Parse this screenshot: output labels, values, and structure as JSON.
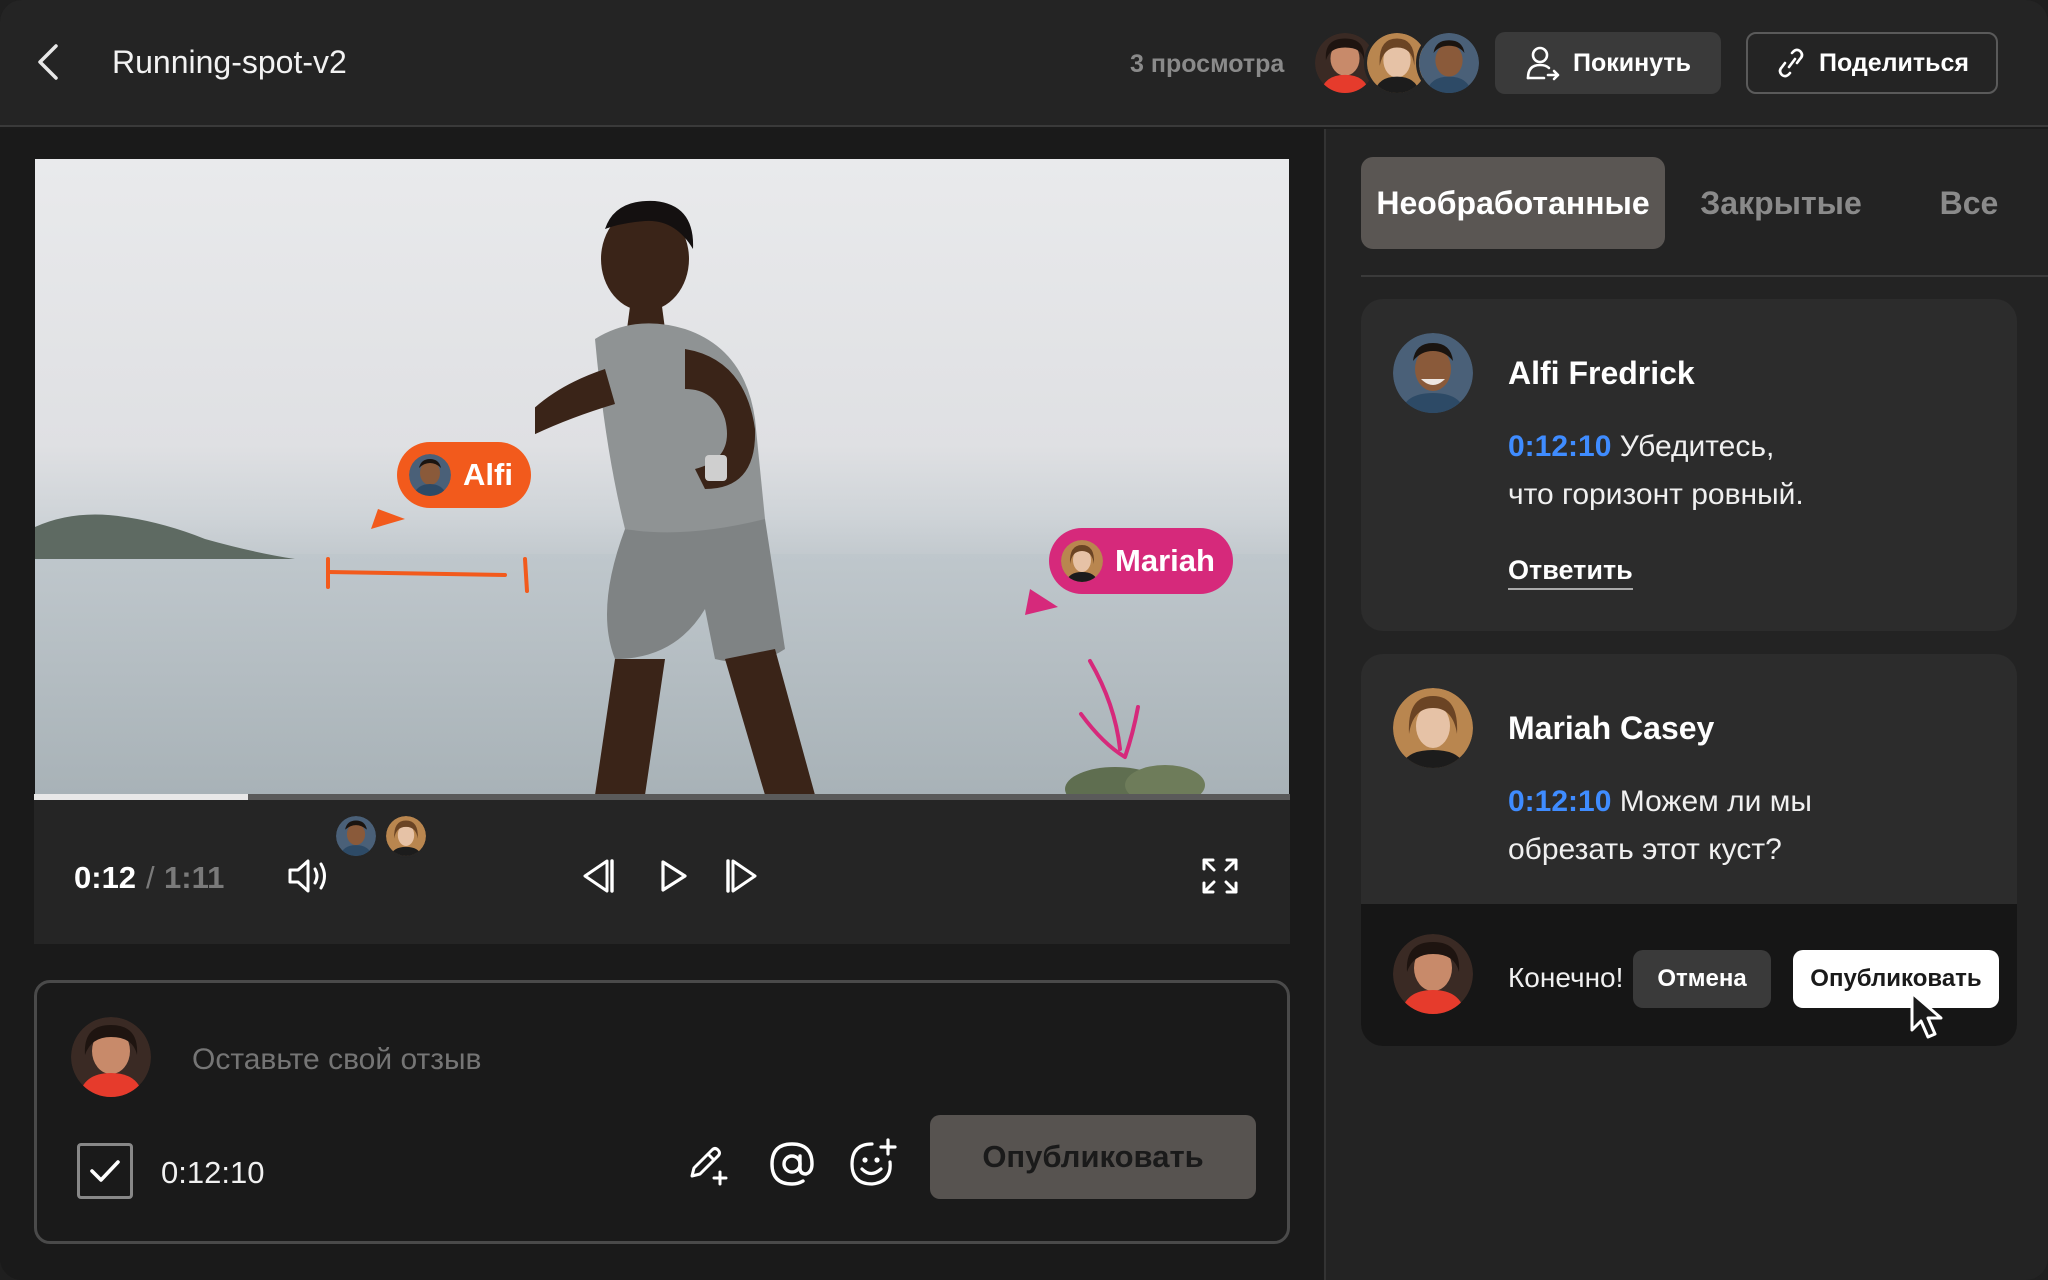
{
  "header": {
    "title": "Running-spot-v2",
    "views": "3 просмотра",
    "leave_label": "Покинуть",
    "share_label": "Поделиться"
  },
  "video": {
    "pins": [
      {
        "name": "Alfi",
        "color": "#f25a1c"
      },
      {
        "name": "Mariah",
        "color": "#d6297b"
      }
    ],
    "progress": 0.17
  },
  "controls": {
    "current": "0:12",
    "separator": "/",
    "total": "1:11"
  },
  "composer": {
    "placeholder": "Оставьте свой отзыв",
    "timestamp": "0:12:10",
    "publish_label": "Опубликовать"
  },
  "tabs": [
    {
      "label": "Необработанные",
      "active": true
    },
    {
      "label": "Закрытые",
      "active": false
    },
    {
      "label": "Все",
      "active": false
    }
  ],
  "comments": [
    {
      "author": "Alfi Fredrick",
      "stamp": "0:12:10",
      "text": "Убедитесь,",
      "text2": "что горизонт ровный.",
      "reply_label": "Ответить"
    },
    {
      "author": "Mariah Casey",
      "stamp": "0:12:10",
      "text": "Можем ли мы",
      "text2": "обрезать этот куст?",
      "draft": "Конечно!",
      "cancel_label": "Отмена",
      "publish_label": "Опубликовать"
    }
  ],
  "colors": {
    "accent_blue": "#3f8cff",
    "alfi_orange": "#f25a1c",
    "mariah_pink": "#d6297b"
  }
}
